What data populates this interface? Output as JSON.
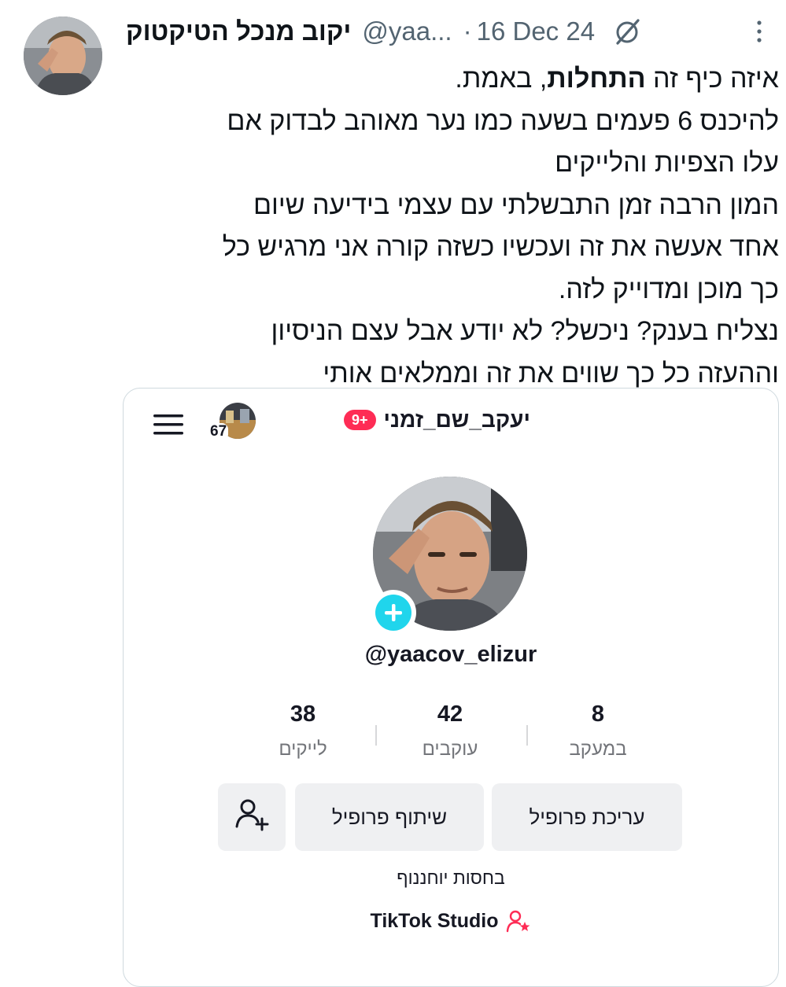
{
  "tweet": {
    "author_name": "יקוב מנכל הטיקטוק",
    "handle": "@yaa...",
    "separator": "·",
    "date": "16 Dec 24",
    "body_lines": [
      [
        "איזה כיף זה ",
        "התחלות",
        ", באמת."
      ],
      "להיכנס 6 פעמים בשעה כמו נער מאוהב לבדוק אם",
      "עלו הצפיות והלייקים",
      "המון הרבה זמן התבשלתי עם עצמי בידיעה שיום",
      "אחד אעשה את זה ועכשיו כשזה קורה אני מרגיש כל",
      "כך מוכן ומדוייק לזה.",
      "נצליח בענק? ניכשל? לא יודע אבל עצם הניסיון",
      "וההעזה כל כך שווים את זה וממלאים אותי"
    ],
    "line1_pre": "איזה כיף זה ",
    "line1_bold": "התחלות",
    "line1_post": ", באמת.",
    "line2": "להיכנס 6 פעמים בשעה כמו נער מאוהב לבדוק אם",
    "line3": "עלו הצפיות והלייקים",
    "line4": "המון הרבה זמן התבשלתי עם עצמי בידיעה שיום",
    "line5": "אחד אעשה את זה ועכשיו כשזה קורה אני מרגיש כל",
    "line6": "כך מוכן ומדוייק לזה.",
    "line7": "נצליח בענק? ניכשל? לא יודע אבל עצם הניסיון",
    "line8": "וההעזה כל כך שווים את זה וממלאים אותי"
  },
  "tiktok": {
    "title": "יעקב_שם_זמני",
    "notification_badge": "9+",
    "story_count": "67",
    "username": "@yaacov_elizur",
    "stats": [
      {
        "value": "38",
        "label": "לייקים"
      },
      {
        "value": "42",
        "label": "עוקבים"
      },
      {
        "value": "8",
        "label": "במעקב"
      }
    ],
    "buttons": {
      "share_profile": "שיתוף פרופיל",
      "edit_profile": "עריכת פרופיל"
    },
    "bio_link": "בחסות יוחננוף",
    "studio_label": "TikTok Studio"
  },
  "colors": {
    "muted_text": "#536471",
    "tiktok_red": "#fe2c55",
    "tiktok_cyan": "#20d5ec",
    "button_bg": "#eff0f2"
  },
  "icons": [
    "grok-icon",
    "more-icon",
    "menu-icon",
    "add-friend-icon",
    "studio-icon",
    "plus-icon"
  ]
}
